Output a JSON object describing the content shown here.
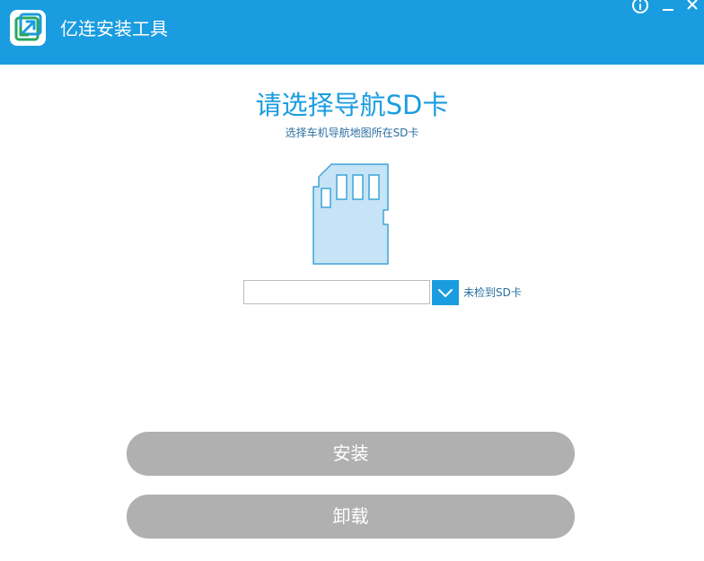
{
  "app": {
    "title": "亿连安装工具",
    "logo_icon": "sync-arrows-icon"
  },
  "window_controls": {
    "info_icon": "info-icon",
    "minimize_icon": "minimize-icon",
    "close_icon": "close-icon"
  },
  "main": {
    "heading": "请选择导航SD卡",
    "subheading": "选择车机导航地图所在SD卡",
    "illustration_icon": "sd-card-icon",
    "drive_select": {
      "value": "",
      "dropdown_icon": "chevron-down-icon"
    },
    "status": "未检到SD卡"
  },
  "buttons": {
    "install": "安装",
    "uninstall": "卸载"
  },
  "colors": {
    "titlebar": "#1a9ce0",
    "accent": "#1a9ce0",
    "button_disabled": "#b0b0b0",
    "sd_card_fill": "#c6e4f5",
    "sd_card_stroke": "#3fa3d9"
  }
}
